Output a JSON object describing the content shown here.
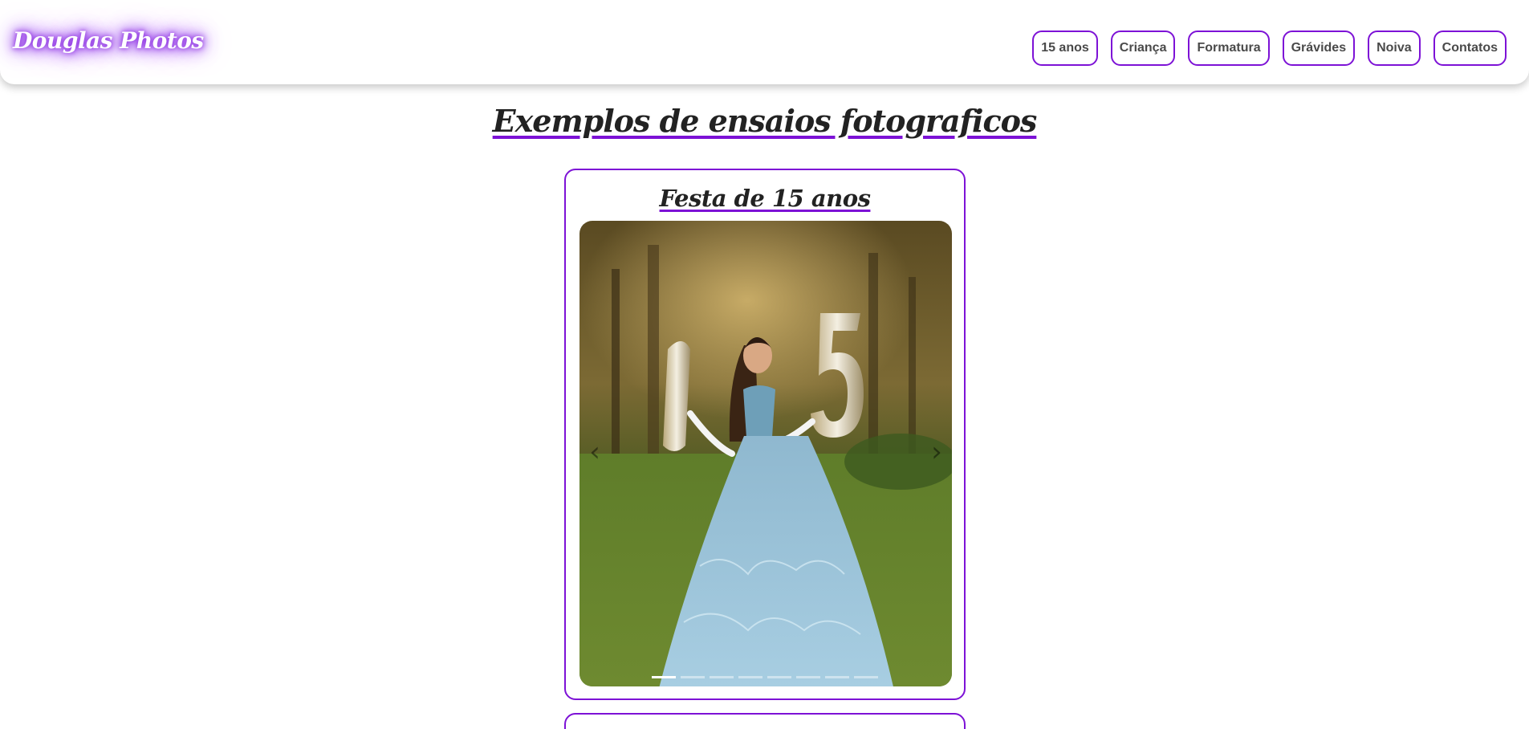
{
  "brand": {
    "name": "Douglas Photos",
    "accent_color": "#7d12d6"
  },
  "nav": {
    "items": [
      {
        "label": "15 anos"
      },
      {
        "label": "Criança"
      },
      {
        "label": "Formatura"
      },
      {
        "label": "Grávides"
      },
      {
        "label": "Noiva"
      },
      {
        "label": "Contatos"
      }
    ]
  },
  "main": {
    "title": "Exemplos de ensaios fotograficos",
    "cards": [
      {
        "title": "Festa de 15 anos",
        "carousel": {
          "slide_count": 8,
          "active_slide": 1,
          "prev_icon": "chevron-left-icon",
          "next_icon": "chevron-right-icon"
        }
      }
    ]
  }
}
